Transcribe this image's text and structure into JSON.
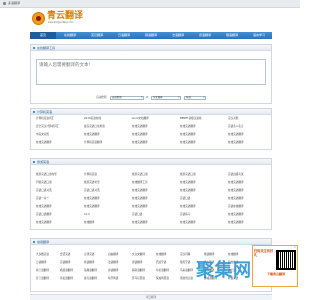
{
  "tab": {
    "title": "多语翻译",
    "icon": "page-icon"
  },
  "header": {
    "logo_title": "青云翻译",
    "logo_subtitle": "www.qingyunfanyi.com"
  },
  "nav": {
    "items": [
      {
        "label": "首页",
        "active": true
      },
      {
        "label": "在线翻译"
      },
      {
        "label": "英汉翻译"
      },
      {
        "label": "日语翻译"
      },
      {
        "label": "韩语翻译"
      },
      {
        "label": "法语翻译"
      },
      {
        "label": "德语翻译"
      },
      {
        "label": "俄语翻译"
      },
      {
        "label": "语言学习"
      }
    ]
  },
  "translator": {
    "panel_title": "在线翻译工具",
    "placeholder": "请输入您需要翻译的文本!",
    "source_label": "自动检测",
    "source_value": "自动检测",
    "swap_label": "⇄",
    "target_label": "中文简体",
    "target_value": "中文简体",
    "engine_value": "有道"
  },
  "section_computer": {
    "title": "计算机英语",
    "links": [
      "计算机英语词汇",
      "2018英语在线",
      "word文档翻译",
      "BENET初级汉语练",
      "英汉对照",
      "安全英汉计算机词汇",
      "提高英语日常用语",
      "在线英语翻译",
      "在线英语翻译",
      "英语名人名言",
      "中英文对照",
      "在线英语翻译",
      "在线英语翻译",
      "在线英语翻译",
      "在线英语翻译",
      "在线英语翻译",
      "计算机英语翻译",
      "在线英语翻译",
      "在线英语翻译",
      "在线英语翻译"
    ]
  },
  "section_travel": {
    "title": "旅游英语",
    "links": [
      "旅游英语口语句型",
      "计算机英语",
      "旅游英语口语",
      "旅游英语口语",
      "英语四级考试",
      "问候英语口语",
      "旅游英语句型",
      "在线翻译工具",
      "在线英语翻译",
      "在线英语翻译",
      "英语口语对话",
      "英语口语对话",
      "在线英语翻译",
      "在线英语翻译",
      "在线英语翻译",
      "英语一对一",
      "在线英语翻译",
      "在线英语翻译",
      "英语口语",
      "在线英语翻译",
      "在线英语翻译",
      "在线英语翻译",
      "在线英语翻译",
      "在线英语翻译",
      "英语在线翻译",
      "英语口语翻译",
      "cd-4",
      "英语口语",
      "英语练习",
      "在线英语翻译",
      "在线英语翻译",
      "在线翻译",
      "在线英语翻译",
      "在线英语翻译",
      "在线英语翻译"
    ]
  },
  "section_common": {
    "title": "常用翻译",
    "links": [
      "大多数英语",
      "会话英语",
      "汉译英语",
      "自由翻译",
      "文言文翻译",
      "在线翻译",
      "英汉词典",
      "俄语翻译",
      "在线翻译",
      "日语翻译",
      "英语翻译",
      "韩语翻译",
      "法语翻译",
      "德语翻译",
      "西班牙语",
      "葡萄牙语",
      "意大利语",
      "阿拉伯语",
      "荷兰语翻译",
      "希腊语翻译",
      "瑞典语翻译",
      "泰语翻译",
      "越南语翻译",
      "印尼语翻译",
      "马来语翻译",
      "土耳其语",
      "波兰语",
      "芬兰语翻译",
      "丹麦语翻译",
      "捷克语翻译",
      "匈牙利语",
      "罗马尼亚语",
      "保加利亚语",
      "斯洛伐克语",
      "挪威语翻译",
      "希伯来语"
    ]
  },
  "footer": {
    "text": "青云翻译"
  },
  "ad": {
    "headline": "扫码关注有好礼",
    "subline": "下载青云翻译",
    "close": "×"
  },
  "watermark": "聚集网"
}
